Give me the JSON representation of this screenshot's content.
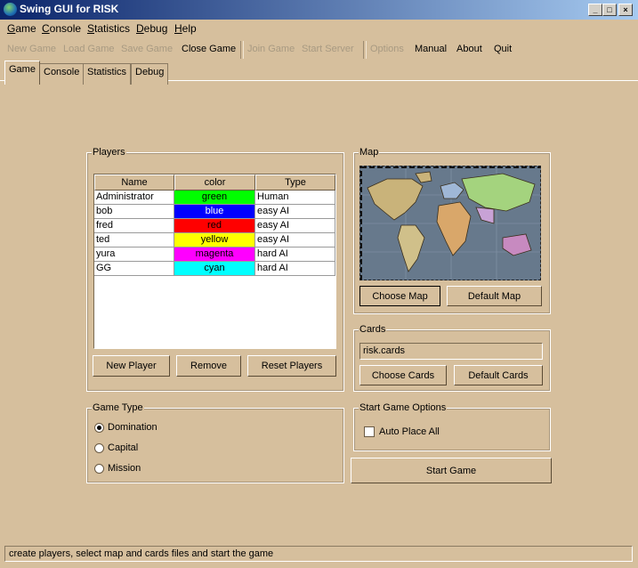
{
  "window": {
    "title": "Swing GUI for RISK",
    "minimize": "_",
    "maximize": "□",
    "close": "×"
  },
  "menu": [
    {
      "label": "Game",
      "mnemonic": "G",
      "rest": "ame"
    },
    {
      "label": "Console",
      "mnemonic": "C",
      "rest": "onsole"
    },
    {
      "label": "Statistics",
      "mnemonic": "S",
      "rest": "tatistics"
    },
    {
      "label": "Debug",
      "mnemonic": "D",
      "rest": "ebug"
    },
    {
      "label": "Help",
      "mnemonic": "H",
      "rest": "elp"
    }
  ],
  "toolbar": {
    "new_game": "New Game",
    "load_game": "Load Game",
    "save_game": "Save Game",
    "close_game": "Close Game",
    "join_game": "Join Game",
    "start_server": "Start Server",
    "options": "Options",
    "manual": "Manual",
    "about": "About",
    "quit": "Quit"
  },
  "tabs": [
    "Game",
    "Console",
    "Statistics",
    "Debug"
  ],
  "players": {
    "title": "Players",
    "columns": [
      "Name",
      "color",
      "Type"
    ],
    "rows": [
      {
        "name": "Administrator",
        "color": "green",
        "hex": "#00ff00",
        "text": "#000000",
        "type": "Human"
      },
      {
        "name": "bob",
        "color": "blue",
        "hex": "#0000ff",
        "text": "#ffffff",
        "type": "easy AI"
      },
      {
        "name": "fred",
        "color": "red",
        "hex": "#ff0000",
        "text": "#000000",
        "type": "easy AI"
      },
      {
        "name": "ted",
        "color": "yellow",
        "hex": "#ffff00",
        "text": "#000000",
        "type": "easy AI"
      },
      {
        "name": "yura",
        "color": "magenta",
        "hex": "#ff00ff",
        "text": "#000000",
        "type": "hard AI"
      },
      {
        "name": "GG",
        "color": "cyan",
        "hex": "#00ffff",
        "text": "#000000",
        "type": "hard AI"
      }
    ],
    "new_player": "New Player",
    "remove": "Remove",
    "reset_players": "Reset Players"
  },
  "map": {
    "title": "Map",
    "choose_map": "Choose Map",
    "default_map": "Default Map"
  },
  "cards": {
    "title": "Cards",
    "file": "risk.cards",
    "choose_cards": "Choose Cards",
    "default_cards": "Default Cards"
  },
  "game_type": {
    "title": "Game Type",
    "options": [
      "Domination",
      "Capital",
      "Mission"
    ],
    "selected": "Domination"
  },
  "start_options": {
    "title": "Start Game Options",
    "auto_place_all": "Auto Place All"
  },
  "start_game": "Start Game",
  "status": "create players, select map and cards files and start the game"
}
